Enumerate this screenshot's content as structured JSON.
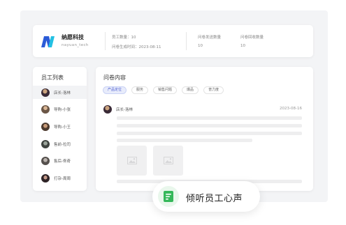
{
  "header": {
    "company_name": "纳愿科技",
    "company_sub": "nayuan_tech",
    "employee_count": "员工数量：10",
    "survey_generated": "问卷生成时间：2023-08-11",
    "survey_sent_label": "问卷发送数量",
    "survey_sent_value": "10",
    "survey_returned_label": "问卷回收数量",
    "survey_returned_value": "10"
  },
  "employee_list": {
    "title": "员工列表",
    "items": [
      {
        "label": "店长-洛林",
        "active": true
      },
      {
        "label": "导购-小张",
        "active": false
      },
      {
        "label": "导购-小王",
        "active": false
      },
      {
        "label": "售前-拉司",
        "active": false
      },
      {
        "label": "售后-佟奇",
        "active": false
      },
      {
        "label": "打杂-周周",
        "active": false
      }
    ]
  },
  "content": {
    "title": "问卷内容",
    "tabs": [
      "产品定位",
      "服务",
      "销售问题",
      "爆品",
      "普力度"
    ],
    "active_tab": "产品定位",
    "post_author": "店长-洛林",
    "post_date": "2023-08-16"
  },
  "callout": {
    "label": "倾听员工心声"
  },
  "colors": {
    "brand_blue": "#2b5bd7",
    "brand_cyan": "#23c0e3",
    "tab_active": "#4a5bd0",
    "callout_green": "#35b85a"
  }
}
